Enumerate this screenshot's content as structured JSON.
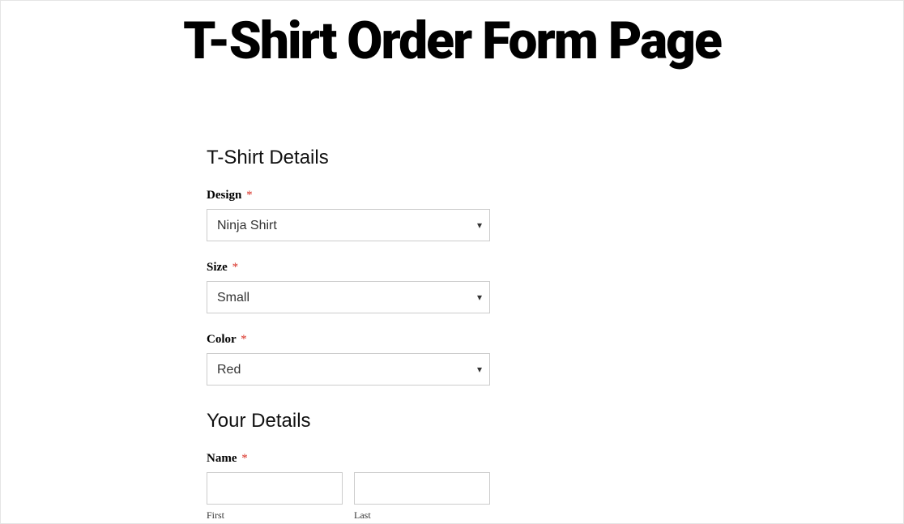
{
  "page": {
    "title": "T-Shirt Order Form Page"
  },
  "sections": {
    "tshirt_details": {
      "heading": "T-Shirt Details",
      "design": {
        "label": "Design",
        "required_marker": "*",
        "selected": "Ninja Shirt"
      },
      "size": {
        "label": "Size",
        "required_marker": "*",
        "selected": "Small"
      },
      "color": {
        "label": "Color",
        "required_marker": "*",
        "selected": "Red"
      }
    },
    "your_details": {
      "heading": "Your Details",
      "name": {
        "label": "Name",
        "required_marker": "*",
        "first": {
          "value": "",
          "sublabel": "First"
        },
        "last": {
          "value": "",
          "sublabel": "Last"
        }
      }
    }
  }
}
